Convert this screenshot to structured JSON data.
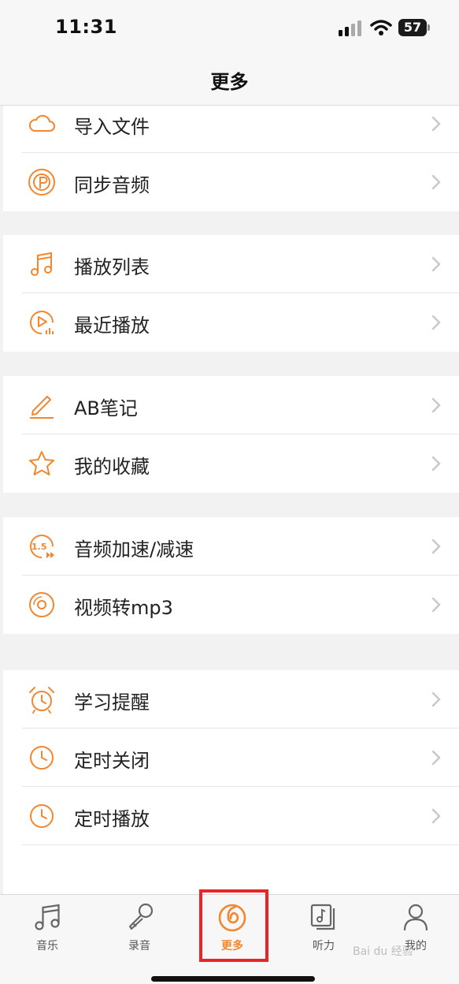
{
  "status_bar": {
    "time": "11:31",
    "battery": "57"
  },
  "header": {
    "title": "更多"
  },
  "colors": {
    "accent": "#f2872f",
    "chevron": "#c7c7cc"
  },
  "groups": [
    {
      "items": [
        {
          "label": "导入文件",
          "icon": "cloud-icon"
        },
        {
          "label": "同步音频",
          "icon": "podcast-icon"
        }
      ]
    },
    {
      "items": [
        {
          "label": "播放列表",
          "icon": "music-note-icon"
        },
        {
          "label": "最近播放",
          "icon": "recent-play-icon"
        }
      ]
    },
    {
      "items": [
        {
          "label": "AB笔记",
          "icon": "pen-icon"
        },
        {
          "label": "我的收藏",
          "icon": "star-icon"
        }
      ]
    },
    {
      "items": [
        {
          "label": "音频加速/减速",
          "icon": "speed-icon"
        },
        {
          "label": "视频转mp3",
          "icon": "disc-icon"
        }
      ]
    },
    {
      "items": [
        {
          "label": "学习提醒",
          "icon": "alarm-clock-icon"
        },
        {
          "label": "定时关闭",
          "icon": "clock-icon"
        },
        {
          "label": "定时播放",
          "icon": "clock-icon"
        }
      ]
    }
  ],
  "tabs": [
    {
      "label": "音乐",
      "icon": "music-icon"
    },
    {
      "label": "录音",
      "icon": "microphone-icon"
    },
    {
      "label": "更多",
      "icon": "more-logo-icon",
      "active": true
    },
    {
      "label": "听力",
      "icon": "listening-icon"
    },
    {
      "label": "我的",
      "icon": "user-icon"
    }
  ],
  "watermark": "Bai du 经验"
}
